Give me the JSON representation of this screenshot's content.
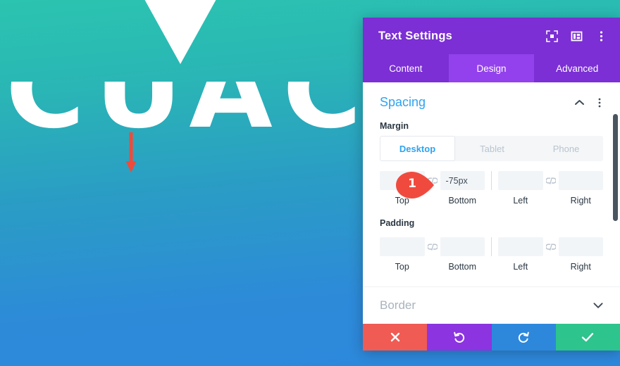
{
  "canvas": {
    "headline_text": "CUACH",
    "notch_icon": "triangle-down-shape",
    "arrow_icon": "red-down-arrow",
    "bg_top_color": "#2bc4b0",
    "bg_bottom_color": "#2d88dc"
  },
  "modal": {
    "title": "Text Settings",
    "header_icons": [
      {
        "name": "focus-target-icon",
        "glyph": "focus"
      },
      {
        "name": "layout-columns-icon",
        "glyph": "columns"
      },
      {
        "name": "more-options-icon",
        "glyph": "kebab"
      }
    ],
    "tabs": [
      {
        "label": "Content",
        "active": false
      },
      {
        "label": "Design",
        "active": true
      },
      {
        "label": "Advanced",
        "active": false
      }
    ],
    "section": {
      "title": "Spacing",
      "collapse_icon": "chevron-up-icon",
      "options_icon": "more-options-icon"
    },
    "margin": {
      "label": "Margin",
      "devices": [
        {
          "label": "Desktop",
          "active": true
        },
        {
          "label": "Tablet",
          "active": false
        },
        {
          "label": "Phone",
          "active": false
        }
      ],
      "fields": [
        {
          "caption": "Top",
          "value": "",
          "placeholder": ""
        },
        {
          "caption": "Bottom",
          "value": "-75px",
          "placeholder": ""
        },
        {
          "caption": "Left",
          "value": "",
          "placeholder": ""
        },
        {
          "caption": "Right",
          "value": "",
          "placeholder": ""
        }
      ],
      "link_icon": "broken-link-icon"
    },
    "padding": {
      "label": "Padding",
      "fields": [
        {
          "caption": "Top",
          "value": "",
          "placeholder": ""
        },
        {
          "caption": "Bottom",
          "value": "",
          "placeholder": ""
        },
        {
          "caption": "Left",
          "value": "",
          "placeholder": ""
        },
        {
          "caption": "Right",
          "value": "",
          "placeholder": ""
        }
      ],
      "link_icon": "broken-link-icon"
    },
    "next_section": {
      "title": "Border",
      "expand_icon": "chevron-down-icon"
    },
    "actions": [
      {
        "name": "cancel-button",
        "icon": "close-x-icon",
        "color": "#f05b54"
      },
      {
        "name": "undo-button",
        "icon": "undo-icon",
        "color": "#8b34e0"
      },
      {
        "name": "redo-button",
        "icon": "redo-icon",
        "color": "#2d88dc"
      },
      {
        "name": "save-button",
        "icon": "checkmark-icon",
        "color": "#2dc48d"
      }
    ]
  },
  "annotation": {
    "marker_number": "1",
    "marker_color": "#f04a3f"
  }
}
